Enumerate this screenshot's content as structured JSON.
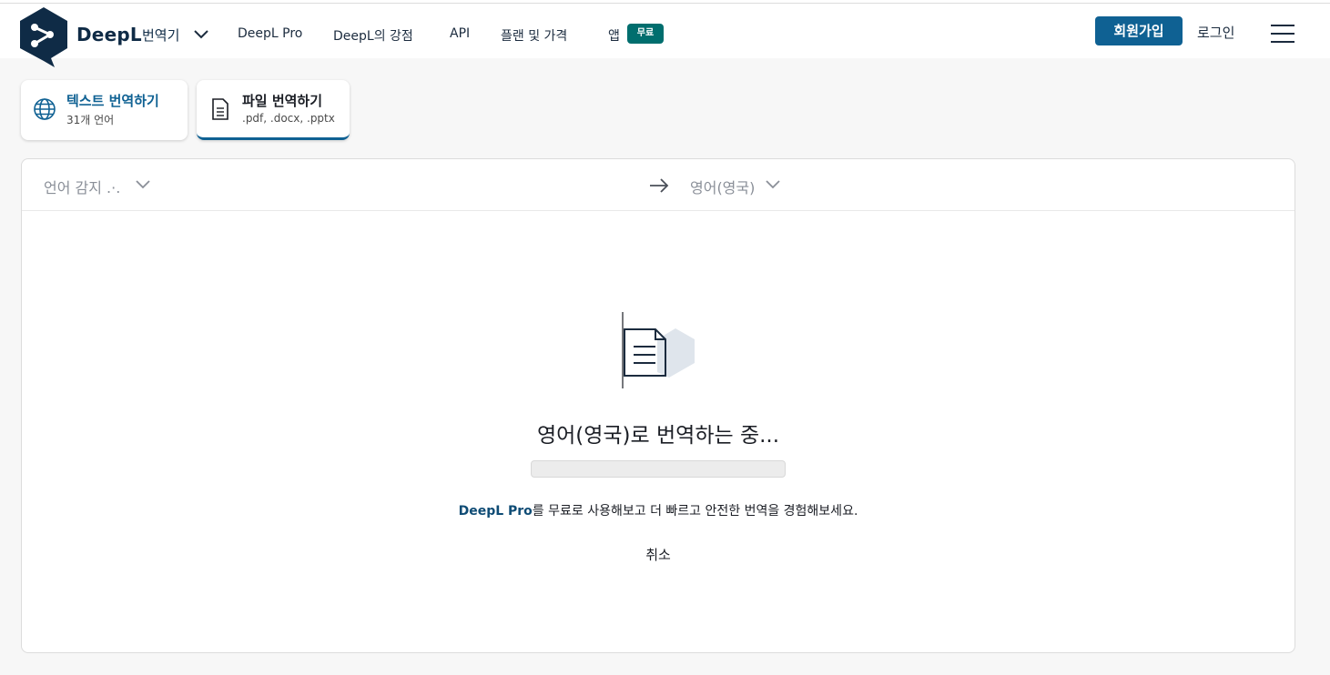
{
  "header": {
    "brand": "DeepL",
    "product": "번역기",
    "nav": [
      "DeepL Pro",
      "DeepL의 강점",
      "API",
      "플랜 및 가격",
      "앱"
    ],
    "app_badge": "무료",
    "signup": "회원가입",
    "login": "로그인"
  },
  "tabs": [
    {
      "title": "텍스트 번역하기",
      "subtitle": "31개 언어"
    },
    {
      "title": "파일 번역하기",
      "subtitle": ".pdf, .docx, .pptx"
    }
  ],
  "langbar": {
    "source": "언어 감지 .·.",
    "target": "영어(영국)"
  },
  "translation": {
    "status": "영어(영국)로 번역하는 중...",
    "progress": 0,
    "promo_link": "DeepL Pro",
    "promo_text": "를 무료로 사용해보고 더 빠르고 안전한 번역을 경험해보세요.",
    "cancel": "취소"
  },
  "colors": {
    "brand_navy": "#0f2b46",
    "accent_blue": "#0f6193",
    "badge_teal": "#006e6e"
  },
  "icons": [
    "deepl-logo-icon",
    "chevron-down-icon",
    "hamburger-menu-icon",
    "globe-icon",
    "document-icon",
    "arrow-right-icon"
  ]
}
